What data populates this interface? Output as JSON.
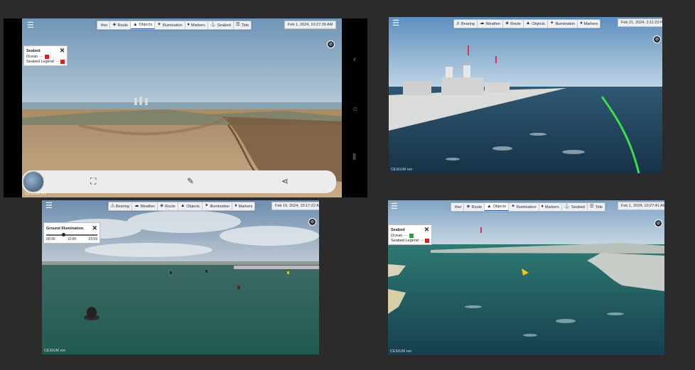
{
  "panel_tl": {
    "toolbar": [
      {
        "icon": "weather-icon",
        "label": "ther",
        "glyph": ""
      },
      {
        "icon": "route-icon",
        "label": "Route",
        "glyph": "◈"
      },
      {
        "icon": "objects-icon",
        "label": "Objects",
        "glyph": "▲",
        "active": true
      },
      {
        "icon": "illumination-icon",
        "label": "Illumination",
        "glyph": "✦"
      },
      {
        "icon": "markers-icon",
        "label": "Markers",
        "glyph": "♦"
      },
      {
        "icon": "seabed-icon",
        "label": "Seabed",
        "glyph": "⚓"
      },
      {
        "icon": "tides-icon",
        "label": "Tide",
        "glyph": "☰"
      }
    ],
    "date": "Feb 1, 2024, 10:27:39 AM",
    "legend": {
      "title": "Seabed",
      "rows": [
        {
          "label": "Ocean",
          "dash": "—",
          "color": "#e01e1e"
        },
        {
          "label": "Seabed Legend",
          "dash": "—",
          "color": "#e01e1e"
        }
      ]
    }
  },
  "panel_tr": {
    "toolbar": [
      {
        "icon": "bearing-icon",
        "label": "Bearing",
        "glyph": "◬"
      },
      {
        "icon": "weather-icon",
        "label": "Weather",
        "glyph": "☁"
      },
      {
        "icon": "route-icon",
        "label": "Route",
        "glyph": "◈"
      },
      {
        "icon": "objects-icon",
        "label": "Objects",
        "glyph": "▲"
      },
      {
        "icon": "illumination-icon",
        "label": "Illumination",
        "glyph": "✦"
      },
      {
        "icon": "markers-icon",
        "label": "Markers",
        "glyph": "♦"
      }
    ],
    "date": "Feb 21, 2024, 2:11:23 PM"
  },
  "panel_bl": {
    "toolbar": [
      {
        "icon": "bearing-icon",
        "label": "Bearing",
        "glyph": "◬"
      },
      {
        "icon": "weather-icon",
        "label": "Weather",
        "glyph": "☁"
      },
      {
        "icon": "route-icon",
        "label": "Route",
        "glyph": "◈"
      },
      {
        "icon": "objects-icon",
        "label": "Objects",
        "glyph": "▲"
      },
      {
        "icon": "illumination-icon",
        "label": "Illumination",
        "glyph": "✦"
      },
      {
        "icon": "markers-icon",
        "label": "Markers",
        "glyph": "♦"
      }
    ],
    "date": "Feb 16, 2024, 10:17:22 AM",
    "illumination": {
      "title": "Ground Illumination",
      "ticks": [
        "00:00",
        "12:00",
        "23:59"
      ],
      "value_fraction": 0.3
    }
  },
  "panel_br": {
    "toolbar": [
      {
        "icon": "weather-icon",
        "label": "ther",
        "glyph": ""
      },
      {
        "icon": "route-icon",
        "label": "Route",
        "glyph": "◈"
      },
      {
        "icon": "objects-icon",
        "label": "Objects",
        "glyph": "▲",
        "active": true
      },
      {
        "icon": "illumination-icon",
        "label": "Illumination",
        "glyph": "✦"
      },
      {
        "icon": "markers-icon",
        "label": "Markers",
        "glyph": "♦"
      },
      {
        "icon": "seabed-icon",
        "label": "Seabed",
        "glyph": "⚓"
      },
      {
        "icon": "tides-icon",
        "label": "Tide",
        "glyph": "☰"
      }
    ],
    "date": "Feb 1, 2024, 10:27:41 AM",
    "legend": {
      "title": "Seabed",
      "rows": [
        {
          "label": "Ocean",
          "dash": "—",
          "color": "#2ea043"
        },
        {
          "label": "Seabed Legend",
          "dash": "—",
          "color": "#e01e1e"
        }
      ]
    }
  },
  "logo": "CESIUM ion",
  "colors": {
    "toolbar_bg": "#eef0f3",
    "accent": "#2f5597",
    "route_green": "#3ddc4b",
    "marker_red": "#e0324a"
  }
}
